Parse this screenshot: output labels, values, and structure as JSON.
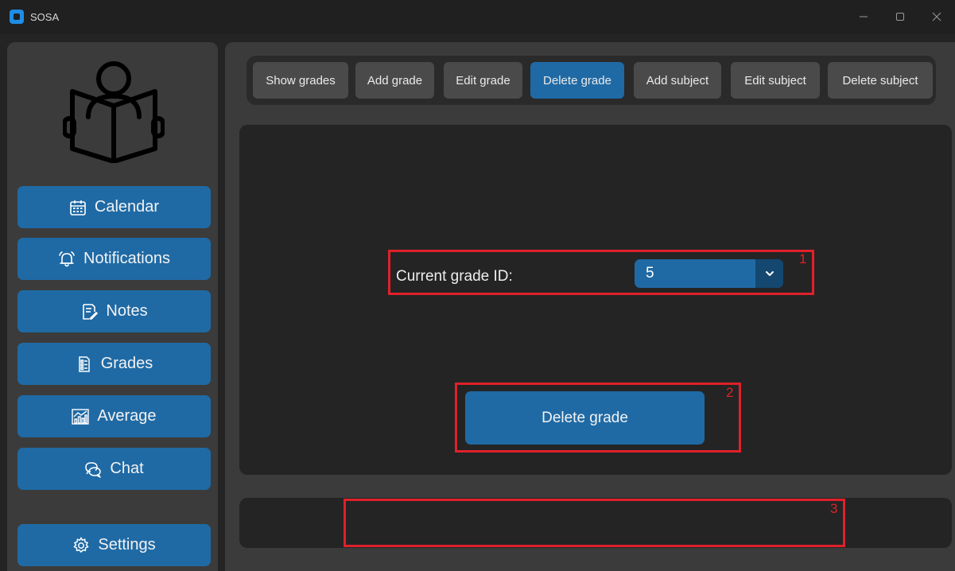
{
  "window": {
    "title": "SOSA",
    "controls": [
      "minimize-icon",
      "maximize-icon",
      "close-icon"
    ]
  },
  "sidebar": {
    "logo_icon": "reading-person-icon",
    "items": [
      {
        "label": "Calendar",
        "icon": "calendar-icon"
      },
      {
        "label": "Notifications",
        "icon": "bell-icon"
      },
      {
        "label": "Notes",
        "icon": "notes-icon"
      },
      {
        "label": "Grades",
        "icon": "grades-icon"
      },
      {
        "label": "Average",
        "icon": "chart-icon"
      },
      {
        "label": "Chat",
        "icon": "chat-icon"
      }
    ],
    "settings": {
      "label": "Settings",
      "icon": "gear-icon"
    }
  },
  "tabs": [
    {
      "label": "Show grades",
      "active": false
    },
    {
      "label": "Add grade",
      "active": false
    },
    {
      "label": "Edit grade",
      "active": false
    },
    {
      "label": "Delete grade",
      "active": true
    },
    {
      "label": "Add subject",
      "active": false
    },
    {
      "label": "Edit subject",
      "active": false
    },
    {
      "label": "Delete subject",
      "active": false
    }
  ],
  "form": {
    "grade_id_label": "Current grade ID:",
    "grade_id_value": "5",
    "delete_button": "Delete grade"
  },
  "status": {
    "message": ""
  },
  "annotations": [
    "1",
    "2",
    "3"
  ],
  "colors": {
    "accent": "#1f6aa5",
    "accent_dark": "#144870",
    "annotation": "#e0202a",
    "panel": "#242424",
    "surface": "#3b3b3b"
  }
}
